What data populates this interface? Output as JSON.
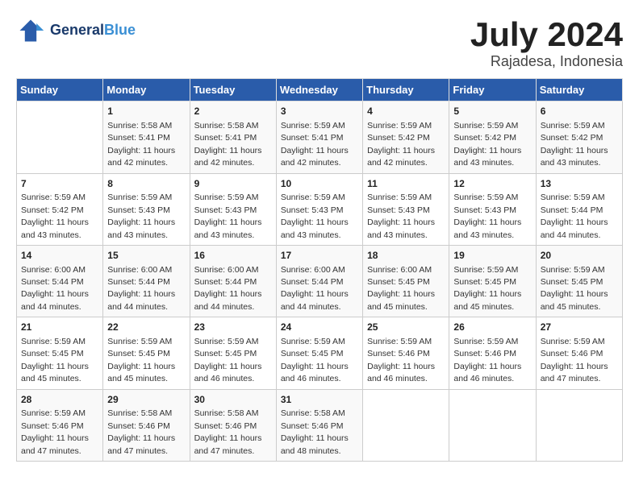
{
  "logo": {
    "line1": "General",
    "line2": "Blue"
  },
  "title": "July 2024",
  "location": "Rajadesa, Indonesia",
  "days_of_week": [
    "Sunday",
    "Monday",
    "Tuesday",
    "Wednesday",
    "Thursday",
    "Friday",
    "Saturday"
  ],
  "weeks": [
    [
      {
        "day": "",
        "info": ""
      },
      {
        "day": "1",
        "info": "Sunrise: 5:58 AM\nSunset: 5:41 PM\nDaylight: 11 hours\nand 42 minutes."
      },
      {
        "day": "2",
        "info": "Sunrise: 5:58 AM\nSunset: 5:41 PM\nDaylight: 11 hours\nand 42 minutes."
      },
      {
        "day": "3",
        "info": "Sunrise: 5:59 AM\nSunset: 5:41 PM\nDaylight: 11 hours\nand 42 minutes."
      },
      {
        "day": "4",
        "info": "Sunrise: 5:59 AM\nSunset: 5:42 PM\nDaylight: 11 hours\nand 42 minutes."
      },
      {
        "day": "5",
        "info": "Sunrise: 5:59 AM\nSunset: 5:42 PM\nDaylight: 11 hours\nand 43 minutes."
      },
      {
        "day": "6",
        "info": "Sunrise: 5:59 AM\nSunset: 5:42 PM\nDaylight: 11 hours\nand 43 minutes."
      }
    ],
    [
      {
        "day": "7",
        "info": "Sunrise: 5:59 AM\nSunset: 5:42 PM\nDaylight: 11 hours\nand 43 minutes."
      },
      {
        "day": "8",
        "info": "Sunrise: 5:59 AM\nSunset: 5:43 PM\nDaylight: 11 hours\nand 43 minutes."
      },
      {
        "day": "9",
        "info": "Sunrise: 5:59 AM\nSunset: 5:43 PM\nDaylight: 11 hours\nand 43 minutes."
      },
      {
        "day": "10",
        "info": "Sunrise: 5:59 AM\nSunset: 5:43 PM\nDaylight: 11 hours\nand 43 minutes."
      },
      {
        "day": "11",
        "info": "Sunrise: 5:59 AM\nSunset: 5:43 PM\nDaylight: 11 hours\nand 43 minutes."
      },
      {
        "day": "12",
        "info": "Sunrise: 5:59 AM\nSunset: 5:43 PM\nDaylight: 11 hours\nand 43 minutes."
      },
      {
        "day": "13",
        "info": "Sunrise: 5:59 AM\nSunset: 5:44 PM\nDaylight: 11 hours\nand 44 minutes."
      }
    ],
    [
      {
        "day": "14",
        "info": "Sunrise: 6:00 AM\nSunset: 5:44 PM\nDaylight: 11 hours\nand 44 minutes."
      },
      {
        "day": "15",
        "info": "Sunrise: 6:00 AM\nSunset: 5:44 PM\nDaylight: 11 hours\nand 44 minutes."
      },
      {
        "day": "16",
        "info": "Sunrise: 6:00 AM\nSunset: 5:44 PM\nDaylight: 11 hours\nand 44 minutes."
      },
      {
        "day": "17",
        "info": "Sunrise: 6:00 AM\nSunset: 5:44 PM\nDaylight: 11 hours\nand 44 minutes."
      },
      {
        "day": "18",
        "info": "Sunrise: 6:00 AM\nSunset: 5:45 PM\nDaylight: 11 hours\nand 45 minutes."
      },
      {
        "day": "19",
        "info": "Sunrise: 5:59 AM\nSunset: 5:45 PM\nDaylight: 11 hours\nand 45 minutes."
      },
      {
        "day": "20",
        "info": "Sunrise: 5:59 AM\nSunset: 5:45 PM\nDaylight: 11 hours\nand 45 minutes."
      }
    ],
    [
      {
        "day": "21",
        "info": "Sunrise: 5:59 AM\nSunset: 5:45 PM\nDaylight: 11 hours\nand 45 minutes."
      },
      {
        "day": "22",
        "info": "Sunrise: 5:59 AM\nSunset: 5:45 PM\nDaylight: 11 hours\nand 45 minutes."
      },
      {
        "day": "23",
        "info": "Sunrise: 5:59 AM\nSunset: 5:45 PM\nDaylight: 11 hours\nand 46 minutes."
      },
      {
        "day": "24",
        "info": "Sunrise: 5:59 AM\nSunset: 5:45 PM\nDaylight: 11 hours\nand 46 minutes."
      },
      {
        "day": "25",
        "info": "Sunrise: 5:59 AM\nSunset: 5:46 PM\nDaylight: 11 hours\nand 46 minutes."
      },
      {
        "day": "26",
        "info": "Sunrise: 5:59 AM\nSunset: 5:46 PM\nDaylight: 11 hours\nand 46 minutes."
      },
      {
        "day": "27",
        "info": "Sunrise: 5:59 AM\nSunset: 5:46 PM\nDaylight: 11 hours\nand 47 minutes."
      }
    ],
    [
      {
        "day": "28",
        "info": "Sunrise: 5:59 AM\nSunset: 5:46 PM\nDaylight: 11 hours\nand 47 minutes."
      },
      {
        "day": "29",
        "info": "Sunrise: 5:58 AM\nSunset: 5:46 PM\nDaylight: 11 hours\nand 47 minutes."
      },
      {
        "day": "30",
        "info": "Sunrise: 5:58 AM\nSunset: 5:46 PM\nDaylight: 11 hours\nand 47 minutes."
      },
      {
        "day": "31",
        "info": "Sunrise: 5:58 AM\nSunset: 5:46 PM\nDaylight: 11 hours\nand 48 minutes."
      },
      {
        "day": "",
        "info": ""
      },
      {
        "day": "",
        "info": ""
      },
      {
        "day": "",
        "info": ""
      }
    ]
  ]
}
